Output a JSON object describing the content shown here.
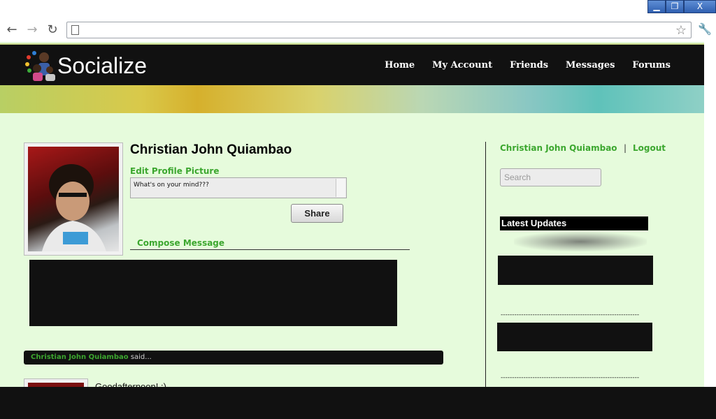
{
  "window": {
    "minimize": "▁",
    "restore": "❐",
    "close": "X"
  },
  "browser": {
    "back": "←",
    "forward": "→",
    "reload": "↻",
    "address": ""
  },
  "site": {
    "logo_text": "Socialize",
    "nav": [
      "Home",
      "My Account",
      "Friends",
      "Messages",
      "Forums"
    ]
  },
  "profile": {
    "name": "Christian John Quiambao",
    "edit_picture": "Edit Profile Picture",
    "status_value": "What's on your mind???",
    "share_label": "Share",
    "compose_label": "Compose Message"
  },
  "feed": {
    "author": "Christian John Quiambao",
    "said": " said...",
    "post_text": "Goodafternoon! :)"
  },
  "sidebar": {
    "user_link": "Christian John Quiambao",
    "separator": "|",
    "logout": "Logout",
    "search_placeholder": "Search",
    "latest_updates": "Latest Updates",
    "dashes": "-------------------------------------------------------------"
  },
  "colors": {
    "accent_green": "#3ca72f",
    "page_bg": "#e6fbdc",
    "header_bg": "#111111"
  }
}
